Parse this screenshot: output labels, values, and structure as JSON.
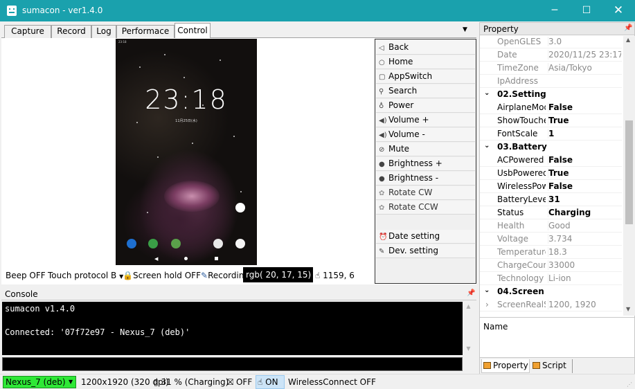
{
  "window": {
    "title": "sumacon - ver1.4.0",
    "minimize_glyph": "─",
    "maximize_glyph": "☐",
    "close_glyph": "✕"
  },
  "tabs": [
    {
      "label": "Capture",
      "active": false
    },
    {
      "label": "Record",
      "active": false
    },
    {
      "label": "Log",
      "active": false
    },
    {
      "label": "Performace",
      "active": false
    },
    {
      "label": "Control",
      "active": true
    }
  ],
  "phone_screen": {
    "clock": "23:18",
    "date": "11月25日(水)",
    "statusbar": "23:18",
    "nav_back": "◀"
  },
  "control_buttons": [
    {
      "label": "Back",
      "icon": "back-triangle-icon",
      "glyph": "◁",
      "enabled": true
    },
    {
      "label": "Home",
      "icon": "home-circle-icon",
      "glyph": "○",
      "enabled": true
    },
    {
      "label": "AppSwitch",
      "icon": "square-icon",
      "glyph": "▢",
      "enabled": true
    },
    {
      "label": "Search",
      "icon": "search-icon",
      "glyph": "⚲",
      "enabled": true
    },
    {
      "label": "Power",
      "icon": "power-bulb-icon",
      "glyph": "♁",
      "enabled": true
    },
    {
      "label": "Volume +",
      "icon": "speaker-icon",
      "glyph": "◀)",
      "enabled": true
    },
    {
      "label": "Volume -",
      "icon": "speaker-icon",
      "glyph": "◀)",
      "enabled": true
    },
    {
      "label": "Mute",
      "icon": "mute-icon",
      "glyph": "⊘",
      "enabled": true
    },
    {
      "label": "Brightness +",
      "icon": "brightness-icon",
      "glyph": "●",
      "enabled": true
    },
    {
      "label": "Brightness -",
      "icon": "brightness-icon",
      "glyph": "●",
      "enabled": true
    },
    {
      "label": "Rotate CW",
      "icon": "rotate-icon",
      "glyph": "✿",
      "enabled": false
    },
    {
      "label": "Rotate CCW",
      "icon": "rotate-icon",
      "glyph": "✿",
      "enabled": false
    },
    {
      "label": "Date setting",
      "icon": "alarm-clock-icon",
      "glyph": "⏰",
      "enabled": true
    },
    {
      "label": "Dev. setting",
      "icon": "pencil-icon",
      "glyph": "✎",
      "enabled": true
    }
  ],
  "toolbar": {
    "beep": "Beep OFF",
    "touch_protocol": "Touch protocol B",
    "screen_hold": "Screen hold OFF",
    "recording": "Recordin",
    "pointer_coords": "1159, 6"
  },
  "rgb_tooltip": "rgb( 20,  17,  15)",
  "console": {
    "title": "Console",
    "lines": "sumacon v1.4.0\n\nConnected: '07f72e97 - Nexus_7 (deb)'"
  },
  "property_panel": {
    "title": "Property",
    "rows": [
      {
        "type": "prop",
        "name": "OpenGLES",
        "value": "3.0",
        "dim": true
      },
      {
        "type": "prop",
        "name": "Date",
        "value": "2020/11/25 23:17",
        "dim": true
      },
      {
        "type": "prop",
        "name": "TimeZone",
        "value": "Asia/Tokyo",
        "dim": true
      },
      {
        "type": "prop",
        "name": "IpAddress",
        "value": "",
        "dim": true
      },
      {
        "type": "cat",
        "name": "02.Setting",
        "chevron": "⌄"
      },
      {
        "type": "prop",
        "name": "AirplaneMod",
        "value": "False",
        "bold": true
      },
      {
        "type": "prop",
        "name": "ShowTouche",
        "value": "True",
        "bold": true
      },
      {
        "type": "prop",
        "name": "FontScale",
        "value": "1",
        "bold": true
      },
      {
        "type": "cat",
        "name": "03.Battery",
        "chevron": "⌄"
      },
      {
        "type": "prop",
        "name": "ACPowered",
        "value": "False",
        "bold": true
      },
      {
        "type": "prop",
        "name": "UsbPowered",
        "value": "True",
        "bold": true
      },
      {
        "type": "prop",
        "name": "WirelessPowe",
        "value": "False",
        "bold": true
      },
      {
        "type": "prop",
        "name": "BatteryLevel",
        "value": "31",
        "bold": true
      },
      {
        "type": "prop",
        "name": "Status",
        "value": "Charging",
        "bold": true
      },
      {
        "type": "prop",
        "name": "Health",
        "value": "Good",
        "dim": true
      },
      {
        "type": "prop",
        "name": "Voltage",
        "value": "3.734",
        "dim": true
      },
      {
        "type": "prop",
        "name": "Temperature",
        "value": "18.3",
        "dim": true
      },
      {
        "type": "prop",
        "name": "ChargeCount",
        "value": "33000",
        "dim": true
      },
      {
        "type": "prop",
        "name": "Technology",
        "value": "Li-ion",
        "dim": true
      },
      {
        "type": "cat",
        "name": "04.Screen",
        "chevron": "⌄"
      },
      {
        "type": "prop",
        "name": "ScreenRealSiz",
        "value": "1200, 1920",
        "dim": true,
        "chevron": "›"
      }
    ],
    "description_name": "Name",
    "tabs": [
      "Property",
      "Script"
    ]
  },
  "statusbar": {
    "device": "Nexus_7 (deb)",
    "resolution": "1200x1920 (320 dpi)",
    "battery": "31 % (Charging)",
    "screen_off": "OFF",
    "touch": "ON",
    "wireless": "WirelessConnect OFF"
  },
  "colors": {
    "titlebar": "#1aa1ad",
    "device_badge": "#2ee836",
    "touch_on_highlight": "#cce4f7"
  }
}
